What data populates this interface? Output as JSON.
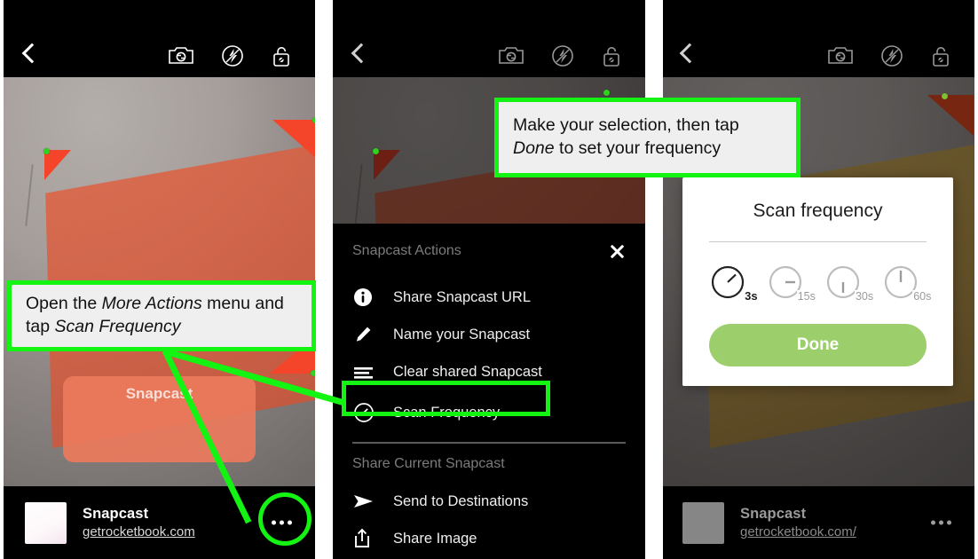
{
  "app": {
    "name": "Snapcast",
    "url": "getrocketbook.com",
    "url_with_slash": "getrocketbook.com/"
  },
  "topbar": {
    "back_label": "Back",
    "icons": [
      {
        "name": "camera-flip-icon",
        "label": "Switch camera"
      },
      {
        "name": "flash-off-icon",
        "label": "Flash off"
      },
      {
        "name": "unlock-icon",
        "label": "Unlocked"
      }
    ]
  },
  "camera": {
    "detected_page_label": "Snapcast",
    "corner_dot_color": "#2fd21f",
    "page_overlay_color": "#e2603f"
  },
  "bottom_bar": {
    "title": "Snapcast",
    "url": "getrocketbook.com",
    "url_dimmed": "getrocketbook.com/",
    "more_button_label": "More Actions"
  },
  "actions_menu": {
    "header": "Snapcast Actions",
    "close_label": "Close",
    "items": [
      {
        "icon": "info-icon",
        "label": "Share Snapcast URL"
      },
      {
        "icon": "pencil-icon",
        "label": "Name your Snapcast"
      },
      {
        "icon": "lines-icon",
        "label": "Clear shared Snapcast"
      },
      {
        "icon": "clock-icon",
        "label": "Scan Frequency"
      }
    ],
    "section_header": "Share Current Snapcast",
    "share_items": [
      {
        "icon": "send-icon",
        "label": "Send to Destinations"
      },
      {
        "icon": "share-icon",
        "label": "Share Image"
      }
    ]
  },
  "scan_frequency_modal": {
    "title": "Scan frequency",
    "options": [
      {
        "label": "3s",
        "selected": true
      },
      {
        "label": "15s",
        "selected": false
      },
      {
        "label": "30s",
        "selected": false
      },
      {
        "label": "60s",
        "selected": false
      }
    ],
    "done_label": "Done",
    "done_color": "#9ccf6b"
  },
  "annotations": {
    "accent_color": "#13f413",
    "callout1": {
      "part1": "Open the ",
      "em1": "More Actions",
      "part2": " menu and tap ",
      "em2": "Scan Frequency"
    },
    "callout2": {
      "part1": "Make your selection, then tap ",
      "em1": "Done",
      "part2": " to set your frequency"
    }
  }
}
